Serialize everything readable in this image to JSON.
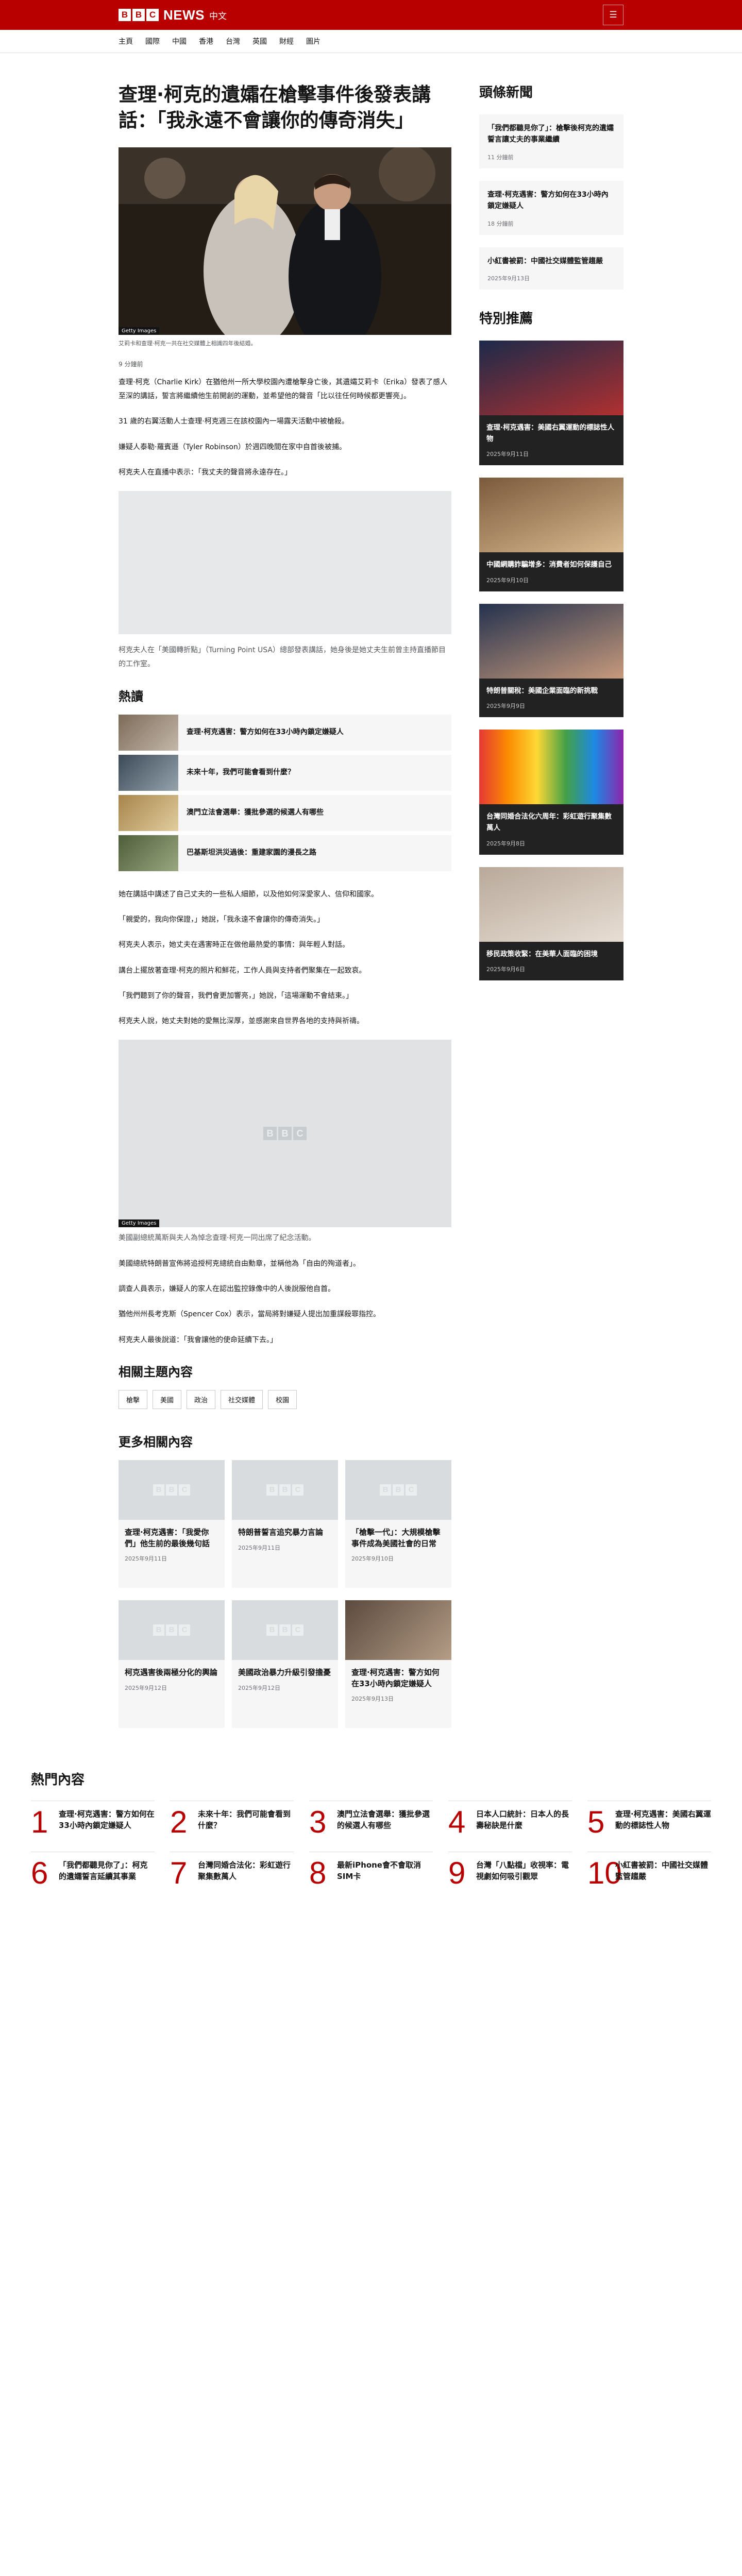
{
  "brand": {
    "logo_letters": [
      "B",
      "B",
      "C"
    ],
    "news": "NEWS",
    "suffix": "中文"
  },
  "menu_icon": "menu-icon",
  "nav": [
    "主頁",
    "國際",
    "中國",
    "香港",
    "台灣",
    "英國",
    "財經",
    "圖片"
  ],
  "article": {
    "headline": "查理·柯克的遺孀在槍擊事件後發表講話：「我永遠不會讓你的傳奇消失」",
    "hero_credit": "Getty Images",
    "hero_caption": "艾莉卡和查理·柯克一共在社交媒體上相識四年後結婚。",
    "byline": "9 分鐘前",
    "paragraphs_a": [
      "查理·柯克（Charlie Kirk）在猶他州一所大學校園內遭槍擊身亡後，其遺孀艾莉卡（Erika）發表了感人至深的講話，誓言將繼續他生前開創的運動，並希望他的聲音「比以往任何時候都更響亮」。",
      "31 歲的右翼活動人士查理·柯克週三在該校園內一場露天活動中被槍殺。",
      "嫌疑人泰勒·羅賓遜（Tyler Robinson）於週四晚間在家中自首後被捕。",
      "柯克夫人在直播中表示：「我丈夫的聲音將永遠存在。」"
    ],
    "media_caption": "柯克夫人在「美國轉折點」（Turning Point USA）總部發表講話，她身後是她丈夫生前曾主持直播節目的工作室。",
    "paragraphs_b": [
      "她在講話中講述了自己丈夫的一些私人細節，以及他如何深愛家人、信仰和國家。",
      "「親愛的，我向你保證，」她說，「我永遠不會讓你的傳奇消失。」",
      "柯克夫人表示，她丈夫在遇害時正在做他最熱愛的事情：與年輕人對話。",
      "講台上擺放著查理·柯克的照片和鮮花，工作人員與支持者們聚集在一起致哀。",
      "「我們聽到了你的聲音，我們會更加響亮，」她說，「這場運動不會結束。」",
      "柯克夫人說，她丈夫對她的愛無比深厚，並感謝來自世界各地的支持與祈禱。"
    ],
    "video_credit": "Getty Images",
    "video_caption": "美國副總統萬斯與夫人為悼念查理·柯克一同出席了紀念活動。",
    "paragraphs_c": [
      "美國總統特朗普宣佈將追授柯克總統自由勳章，並稱他為「自由的殉道者」。",
      "調查人員表示，嫌疑人的家人在認出監控錄像中的人後說服他自首。",
      "猶他州州長考克斯（Spencer Cox）表示，當局將對嫌疑人提出加重謀殺罪指控。",
      "柯克夫人最後說道：「我會讓他的使命延續下去。」"
    ]
  },
  "trending": {
    "title": "熱讀",
    "items": [
      "查理·柯克遇害：警方如何在33小時內鎖定嫌疑人",
      "未來十年，我們可能會看到什麼？",
      "澳門立法會選舉：獲批參選的候選人有哪些",
      "巴基斯坦洪災過後：重建家園的漫長之路"
    ]
  },
  "related": {
    "title": "相關主題內容",
    "topics": [
      "槍擊",
      "美國",
      "政治",
      "社交媒體",
      "校園"
    ]
  },
  "more": {
    "title": "更多相關內容",
    "cards": [
      {
        "title": "查理·柯克遇害：「我愛你們」他生前的最後幾句話",
        "date": "2025年9月11日"
      },
      {
        "title": "特朗普誓言追究暴力言論",
        "date": "2025年9月11日"
      },
      {
        "title": "「槍擊一代」：大規模槍擊事件成為美國社會的日常",
        "date": "2025年9月10日"
      },
      {
        "title": "柯克遇害後兩極分化的輿論",
        "date": "2025年9月12日"
      },
      {
        "title": "美國政治暴力升級引發擔憂",
        "date": "2025年9月12日"
      },
      {
        "title": "查理·柯克遇害：警方如何在33小時內鎖定嫌疑人",
        "date": "2025年9月13日"
      }
    ]
  },
  "aside": {
    "top_title": "頭條新聞",
    "top_news": [
      {
        "title": "「我們都聽見你了」：槍擊後柯克的遺孀誓言讓丈夫的事業繼續",
        "date": "11 分鐘前"
      },
      {
        "title": "查理·柯克遇害：警方如何在33小時內鎖定嫌疑人",
        "date": "18 分鐘前"
      },
      {
        "title": "小紅書被罰：中國社交媒體監管趨嚴",
        "date": "2025年9月13日"
      }
    ],
    "feature_title": "特別推薦",
    "features": [
      {
        "title": "查理·柯克遇害：美國右翼運動的標誌性人物",
        "date": "2025年9月11日"
      },
      {
        "title": "中國網購詐騙增多：消費者如何保護自己",
        "date": "2025年9月10日"
      },
      {
        "title": "特朗普關稅：美國企業面臨的新挑戰",
        "date": "2025年9月9日"
      },
      {
        "title": "台灣同婚合法化六周年：彩虹遊行聚集數萬人",
        "date": "2025年9月8日"
      },
      {
        "title": "移民政策收緊：在美華人面臨的困境",
        "date": "2025年9月6日"
      }
    ]
  },
  "most_read": {
    "title": "熱門內容",
    "items": [
      {
        "num": "1",
        "title": "查理·柯克遇害：警方如何在33小時內鎖定嫌疑人"
      },
      {
        "num": "2",
        "title": "未來十年：我們可能會看到什麼？"
      },
      {
        "num": "3",
        "title": "澳門立法會選舉：獲批參選的候選人有哪些"
      },
      {
        "num": "4",
        "title": "日本人口統計：日本人的長壽秘訣是什麼"
      },
      {
        "num": "5",
        "title": "查理·柯克遇害：美國右翼運動的標誌性人物"
      },
      {
        "num": "6",
        "title": "「我們都聽見你了」：柯克的遺孀誓言延續其事業"
      },
      {
        "num": "7",
        "title": "台灣同婚合法化：彩虹遊行聚集數萬人"
      },
      {
        "num": "8",
        "title": "最新iPhone會不會取消SIM卡"
      },
      {
        "num": "9",
        "title": "台灣「八點檔」收視率：電視劇如何吸引觀眾"
      },
      {
        "num": "10",
        "title": "小紅書被罰：中國社交媒體監管趨嚴"
      }
    ]
  },
  "colors": {
    "brand_red": "#b80000",
    "card_bg": "#f6f6f6",
    "feature_bg": "#222222"
  }
}
